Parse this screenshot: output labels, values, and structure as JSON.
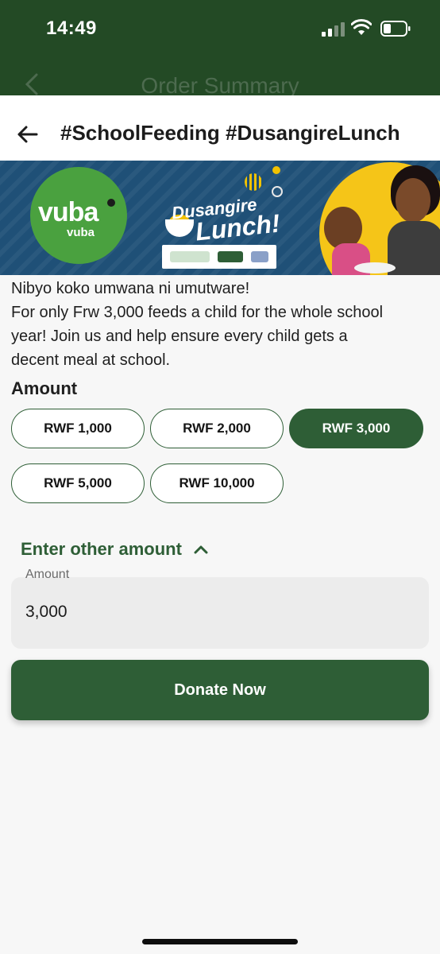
{
  "status_bar": {
    "time": "14:49"
  },
  "underlying_screen": {
    "title": "Order Summary"
  },
  "header": {
    "title": "#SchoolFeeding #DusangireLunch"
  },
  "banner": {
    "brand_name": "vuba",
    "brand_sub": "vuba",
    "campaign_line1": "Dusangire",
    "campaign_line2": "Lunch!"
  },
  "description": {
    "lines": [
      "Nibyo koko umwana ni umutware!",
      "For only Frw 3,000 feeds a child for the whole school",
      "year!  Join us and help ensure every child gets a",
      "decent meal at school."
    ]
  },
  "amount_section": {
    "heading": "Amount",
    "options": [
      "RWF 1,000",
      "RWF 2,000",
      "RWF 3,000",
      "RWF 5,000",
      "RWF 10,000"
    ],
    "selected": "RWF 3,000"
  },
  "other_amount": {
    "toggle_label": "Enter other amount",
    "expanded": true,
    "field_label": "Amount",
    "value": "3,000"
  },
  "donate_button": {
    "label": "Donate Now"
  },
  "colors": {
    "primary": "#2e5e36",
    "status_bar": "#234a25",
    "banner_blue": "#1f5077",
    "banner_yellow": "#f5c518",
    "vuba_green": "#4aa13f"
  },
  "icons": {
    "back": "back-arrow-icon",
    "toggle": "chevron-up-icon"
  }
}
